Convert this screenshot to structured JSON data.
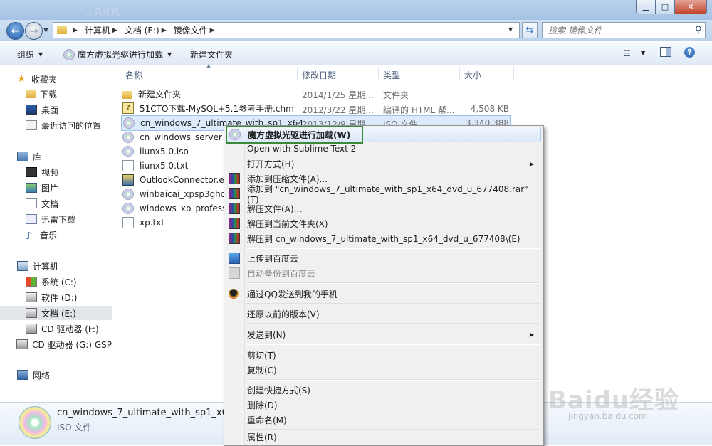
{
  "window": {
    "title_ghost": "工具箱机"
  },
  "address": {
    "crumbs": [
      "计算机",
      "文档 (E:)",
      "镜像文件"
    ],
    "search_placeholder": "搜索 镜像文件"
  },
  "toolbar": {
    "organize": "组织",
    "mount": "魔方虚拟光驱进行加载",
    "new_folder": "新建文件夹"
  },
  "nav": {
    "favorites": "收藏夹",
    "fav_items": [
      "下载",
      "桌面",
      "最近访问的位置"
    ],
    "libraries": "库",
    "lib_items": [
      "视频",
      "图片",
      "文档",
      "迅雷下载",
      "音乐"
    ],
    "computer": "计算机",
    "drives": [
      "系统 (C:)",
      "软件 (D:)",
      "文档 (E:)",
      "CD 驱动器 (F:)",
      "CD 驱动器 (G:) GSP"
    ],
    "network": "网络"
  },
  "columns": {
    "name": "名称",
    "date": "修改日期",
    "type": "类型",
    "size": "大小"
  },
  "files": [
    {
      "name": "新建文件夹",
      "date": "2014/1/25 星期...",
      "type": "文件夹",
      "size": "",
      "icon": "folder-icon"
    },
    {
      "name": "51CTO下载-MySQL+5.1参考手册.chm",
      "date": "2012/3/22 星期...",
      "type": "编译的 HTML 帮...",
      "size": "4,508 KB",
      "icon": "chm-icon"
    },
    {
      "name": "cn_windows_7_ultimate_with_sp1_x64",
      "date": "2013/12/9 星期...",
      "type": "ISO 文件",
      "size": "3,340,388 ...",
      "icon": "iso-icon"
    },
    {
      "name": "cn_windows_server_20",
      "date": "",
      "type": "",
      "size": "",
      "icon": "iso-icon"
    },
    {
      "name": "liunx5.0.iso",
      "date": "",
      "type": "",
      "size": "",
      "icon": "iso-icon"
    },
    {
      "name": "liunx5.0.txt",
      "date": "",
      "type": "",
      "size": "",
      "icon": "txt-icon"
    },
    {
      "name": "OutlookConnector.exe",
      "date": "",
      "type": "",
      "size": "",
      "icon": "exe-icon"
    },
    {
      "name": "winbaicai_xpsp3ghost",
      "date": "",
      "type": "",
      "size": "",
      "icon": "iso-icon"
    },
    {
      "name": "windows_xp_professio",
      "date": "",
      "type": "",
      "size": "",
      "icon": "iso-icon"
    },
    {
      "name": "xp.txt",
      "date": "",
      "type": "",
      "size": "",
      "icon": "txt-icon"
    }
  ],
  "context_menu": [
    "魔方虚拟光驱进行加载(W)",
    "Open with Sublime Text 2",
    "打开方式(H)",
    "添加到压缩文件(A)...",
    "添加到 \"cn_windows_7_ultimate_with_sp1_x64_dvd_u_677408.rar\"(T)",
    "解压文件(A)...",
    "解压到当前文件夹(X)",
    "解压到 cn_windows_7_ultimate_with_sp1_x64_dvd_u_677408\\(E)",
    "上传到百度云",
    "自动备份到百度云",
    "通过QQ发送到我的手机",
    "还原以前的版本(V)",
    "发送到(N)",
    "剪切(T)",
    "复制(C)",
    "创建快捷方式(S)",
    "删除(D)",
    "重命名(M)",
    "属性(R)"
  ],
  "details": {
    "name": "cn_windows_7_ultimate_with_sp1_x64_...",
    "type": "ISO 文件"
  },
  "watermark": {
    "brand": "Baidu经验",
    "url": "jingyan.baidu.com"
  }
}
